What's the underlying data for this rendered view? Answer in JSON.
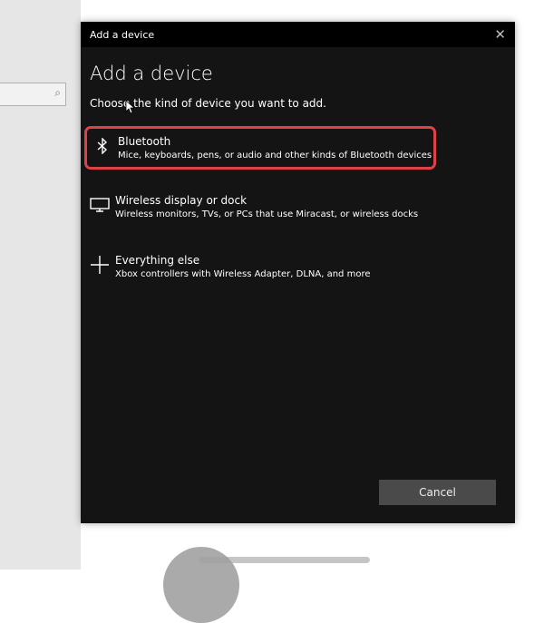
{
  "dialog": {
    "window_title": "Add a device",
    "heading": "Add a device",
    "subtitle": "Choose the kind of device you want to add.",
    "options": [
      {
        "icon": "bluetooth-icon",
        "title": "Bluetooth",
        "desc": "Mice, keyboards, pens, or audio and other kinds of Bluetooth devices",
        "highlighted": true
      },
      {
        "icon": "monitor-icon",
        "title": "Wireless display or dock",
        "desc": "Wireless monitors, TVs, or PCs that use Miracast, or wireless docks"
      },
      {
        "icon": "plus-icon",
        "title": "Everything else",
        "desc": "Xbox controllers with Wireless Adapter, DLNA, and more"
      }
    ],
    "cancel_label": "Cancel"
  },
  "colors": {
    "highlight": "#e04048",
    "dialog_bg": "#141414"
  }
}
